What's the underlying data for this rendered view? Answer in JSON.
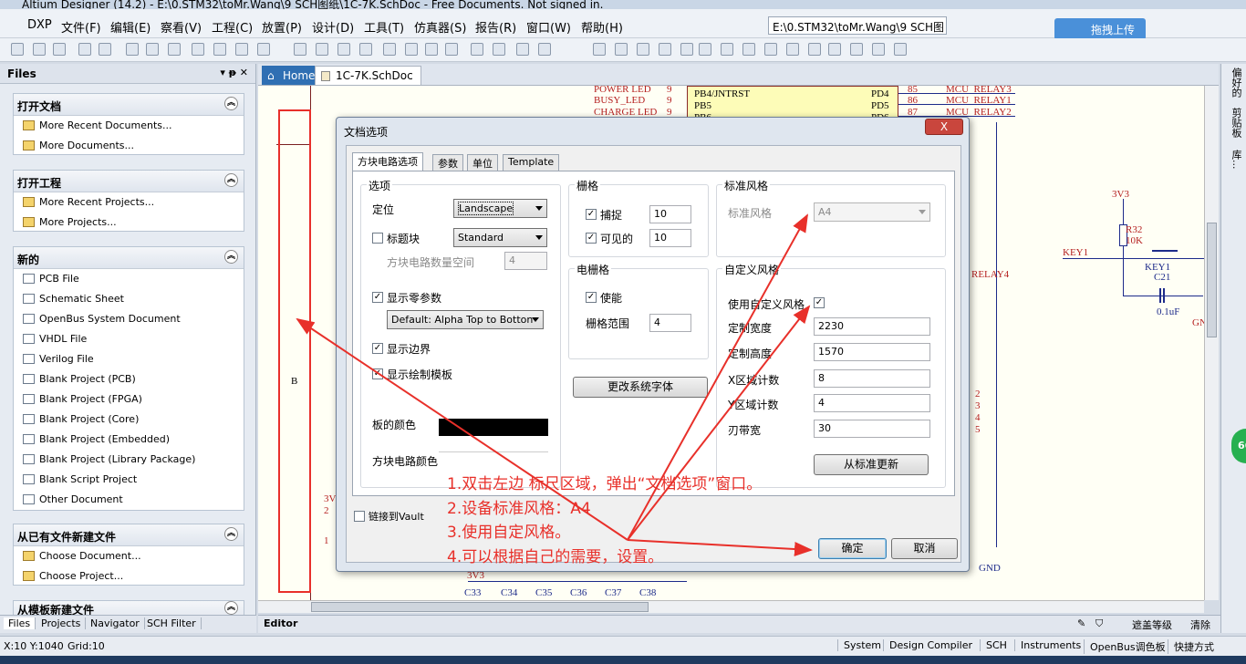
{
  "window": {
    "title": "Altium Designer (14.2) - E:\\0.STM32\\toMr.Wang\\9 SCH图纸\\1C-7K.SchDoc - Free Documents. Not signed in."
  },
  "menu": [
    "DXP",
    "文件(F)",
    "编辑(E)",
    "察看(V)",
    "工程(C)",
    "放置(P)",
    "设计(D)",
    "工具(T)",
    "仿真器(S)",
    "报告(R)",
    "窗口(W)",
    "帮助(H)"
  ],
  "path_box": "E:\\0.STM32\\toMr.Wang\\9 SCH图",
  "upload_btn": "拖拽上传",
  "files_panel": {
    "title": "Files",
    "sections": [
      {
        "title": "打开文档",
        "items": [
          "More Recent Documents...",
          "More Documents..."
        ]
      },
      {
        "title": "打开工程",
        "items": [
          "More Recent Projects...",
          "More Projects..."
        ]
      },
      {
        "title": "新的",
        "items": [
          "PCB File",
          "Schematic Sheet",
          "OpenBus System Document",
          "VHDL File",
          "Verilog File",
          "Blank Project (PCB)",
          "Blank Project (FPGA)",
          "Blank Project (Core)",
          "Blank Project (Embedded)",
          "Blank Project (Library Package)",
          "Blank Script Project",
          "Other Document"
        ]
      },
      {
        "title": "从已有文件新建文件",
        "items": [
          "Choose Document...",
          "Choose Project..."
        ]
      },
      {
        "title": "从模板新建文件",
        "items": []
      }
    ],
    "bottom_tabs": [
      "Files",
      "Projects",
      "Navigator",
      "SCH Filter"
    ]
  },
  "doc_tabs": [
    "Home",
    "1C-7K.SchDoc"
  ],
  "right_tabs": [
    "偏好的",
    "剪贴板",
    "库..."
  ],
  "schematic": {
    "zone_label": "B",
    "pins_left": [
      "POWER LED",
      "BUSY_LED",
      "CHARGE LED"
    ],
    "pin_nums_left": [
      "9",
      "9",
      "9"
    ],
    "pins_mid": [
      "PB4/JNTRST",
      "PB5",
      "PB6"
    ],
    "pins_right": [
      "PD4",
      "PD5",
      "PD6"
    ],
    "pin_nums_right": [
      "85",
      "86",
      "87"
    ],
    "nets_right": [
      "MCU_RELAY3",
      "MCU_RELAY1",
      "MCU_RELAY2"
    ],
    "relay4": "RELAY4",
    "v33": "3V3",
    "r32": "R32",
    "r32v": "10K",
    "key1": "KEY1",
    "key1b": "KEY1",
    "c21": "C21",
    "c21v": "0.1uF",
    "gnd": "GND",
    "gn": "GN",
    "nums": [
      "2",
      "3",
      "4",
      "5"
    ],
    "caps": [
      "C33",
      "C34",
      "C35",
      "C36",
      "C37",
      "C38"
    ],
    "v33b": "3V3",
    "v33c": "3V",
    "v33d": "2",
    "v33e": "1"
  },
  "dialog": {
    "title": "文档选项",
    "close": "X",
    "tabs": [
      "方块电路选项",
      "参数",
      "单位",
      "Template"
    ],
    "options": {
      "label": "选项",
      "orientation_label": "定位",
      "orientation": "Landscape",
      "title_block_label": "标题块",
      "title_block": "Standard",
      "sheet_count_label": "方块电路数量空间",
      "sheet_count": "4",
      "show_zero": "显示零参数",
      "default_order": "Default: Alpha Top to Botton",
      "show_border": "显示边界",
      "show_template": "显示绘制模板",
      "board_color": "板的颜色",
      "sheet_color": "方块电路颜色"
    },
    "grid": {
      "label": "栅格",
      "snap_label": "捕捉",
      "snap": "10",
      "visible_label": "可见的",
      "visible": "10"
    },
    "elec_grid": {
      "label": "电栅格",
      "enable": "使能",
      "range_label": "栅格范围",
      "range": "4"
    },
    "change_font": "更改系统字体",
    "standard": {
      "label": "标准风格",
      "style_label": "标准风格",
      "style": "A4"
    },
    "custom": {
      "label": "自定义风格",
      "use_label": "使用自定义风格",
      "width_label": "定制宽度",
      "width": "2230",
      "height_label": "定制高度",
      "height": "1570",
      "x_label": "X区域计数",
      "x": "8",
      "y_label": "Y区域计数",
      "y": "4",
      "margin_label": "刃带宽",
      "margin": "30",
      "update": "从标准更新"
    },
    "vault": "链接到Vault",
    "ok": "确定",
    "cancel": "取消"
  },
  "note": [
    "1.双击左边 标尺区域，弹出“文档选项”窗口。",
    "2.设备标准风格：A4",
    "3.使用自定风格。",
    "4.可以根据自己的需要，设置。"
  ],
  "editor_tab": "Editor",
  "right_bottom": [
    "遮盖等级",
    "清除"
  ],
  "status": {
    "pos": "X:10 Y:1040",
    "grid": "Grid:10",
    "tabs": [
      "System",
      "Design Compiler",
      "SCH",
      "Instruments",
      "OpenBus调色板",
      "快捷方式"
    ]
  },
  "badge": "66",
  "colors": {
    "arrow": "#e8302a",
    "board": "#000000"
  }
}
